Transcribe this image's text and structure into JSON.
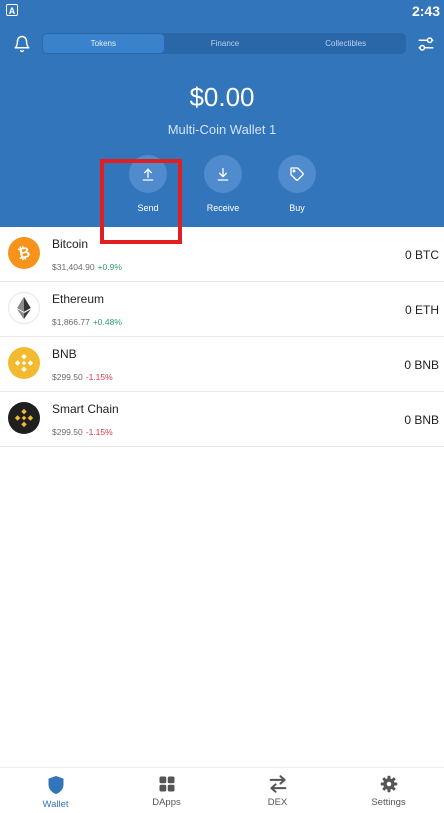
{
  "status_bar": {
    "time": "2:43",
    "app_badge": "A"
  },
  "header": {
    "tabs": [
      {
        "label": "Tokens",
        "active": true
      },
      {
        "label": "Finance",
        "active": false
      },
      {
        "label": "Collectibles",
        "active": false
      }
    ],
    "balance": "$0.00",
    "wallet_name": "Multi-Coin Wallet 1",
    "actions": [
      {
        "label": "Send",
        "icon": "upload-arrow-icon"
      },
      {
        "label": "Receive",
        "icon": "download-arrow-icon"
      },
      {
        "label": "Buy",
        "icon": "tag-icon"
      }
    ]
  },
  "tokens": [
    {
      "name": "Bitcoin",
      "price": "$31,404.90",
      "change": "+0.9%",
      "change_dir": "up",
      "balance": "0 BTC",
      "icon": "bitcoin-logo-icon",
      "color": "#f7931a"
    },
    {
      "name": "Ethereum",
      "price": "$1,866.77",
      "change": "+0.48%",
      "change_dir": "up",
      "balance": "0 ETH",
      "icon": "ethereum-logo-icon",
      "color": "#ffffff"
    },
    {
      "name": "BNB",
      "price": "$299.50",
      "change": "-1.15%",
      "change_dir": "down",
      "balance": "0 BNB",
      "icon": "bnb-logo-icon",
      "color": "#f3ba2f"
    },
    {
      "name": "Smart Chain",
      "price": "$299.50",
      "change": "-1.15%",
      "change_dir": "down",
      "balance": "0 BNB",
      "icon": "smart-chain-logo-icon",
      "color": "#1f1f1f"
    }
  ],
  "nav": [
    {
      "label": "Wallet",
      "icon": "shield-icon",
      "active": true
    },
    {
      "label": "DApps",
      "icon": "grid-icon",
      "active": false
    },
    {
      "label": "DEX",
      "icon": "swap-arrows-icon",
      "active": false
    },
    {
      "label": "Settings",
      "icon": "gear-icon",
      "active": false
    }
  ],
  "colors": {
    "primary": "#3375bb",
    "positive": "#2e9d6a",
    "negative": "#d9384a",
    "highlight": "#e02020"
  }
}
